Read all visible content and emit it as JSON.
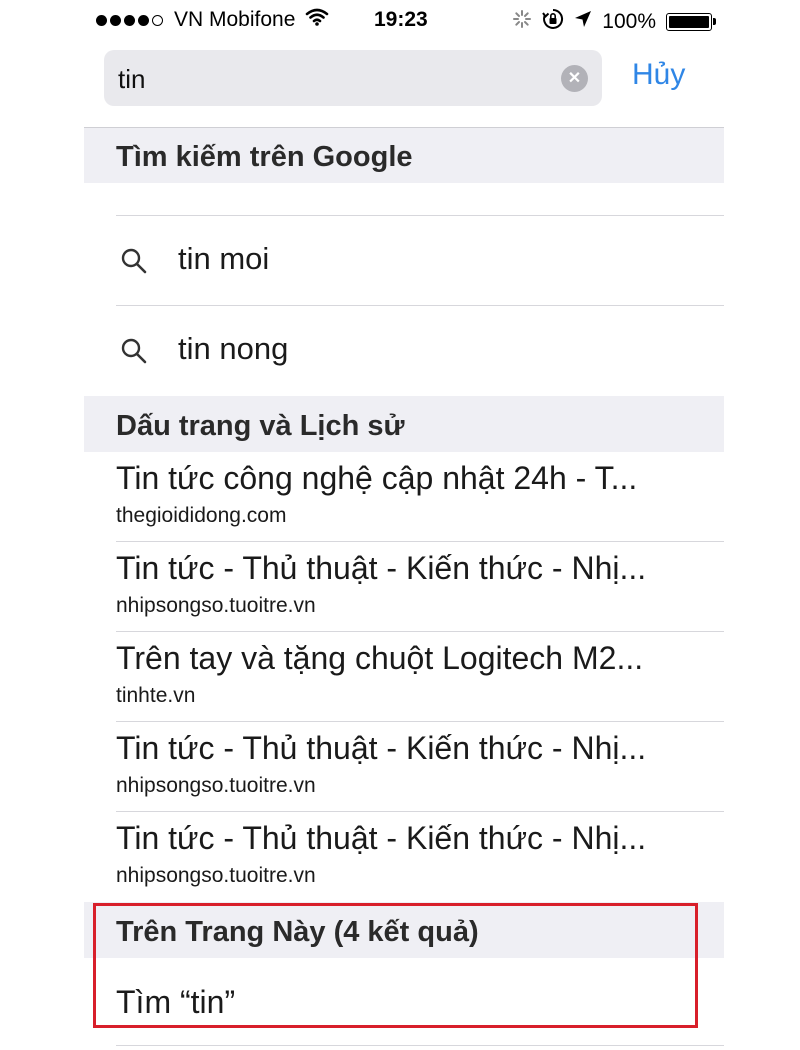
{
  "status_bar": {
    "carrier": "VN Mobifone",
    "time": "19:23",
    "battery": "100%",
    "signal_bars_filled": 4,
    "signal_bars_total": 5
  },
  "search": {
    "query": "tin",
    "cancel_label": "Hủy"
  },
  "google_section": {
    "header": "Tìm kiếm trên Google",
    "suggestions": [
      "tin moi",
      "tin nong"
    ]
  },
  "history_section": {
    "header": "Dấu trang và Lịch sử",
    "items": [
      {
        "title": "Tin tức công nghệ cập nhật 24h - T...",
        "url": "thegioididong.com"
      },
      {
        "title": "Tin tức - Thủ thuật - Kiến thức - Nhị...",
        "url": "nhipsongso.tuoitre.vn"
      },
      {
        "title": "Trên tay và tặng chuột Logitech M2...",
        "url": "tinhte.vn"
      },
      {
        "title": "Tin tức - Thủ thuật - Kiến thức - Nhị...",
        "url": "nhipsongso.tuoitre.vn"
      },
      {
        "title": "Tin tức - Thủ thuật - Kiến thức - Nhị...",
        "url": "nhipsongso.tuoitre.vn"
      }
    ]
  },
  "on_page_section": {
    "header": "Trên Trang Này (4 kết quả)",
    "find_label": "Tìm “tin”"
  },
  "colors": {
    "accent": "#2f86e6",
    "highlight_box": "#d81f2a",
    "section_bg": "#efeff4"
  }
}
